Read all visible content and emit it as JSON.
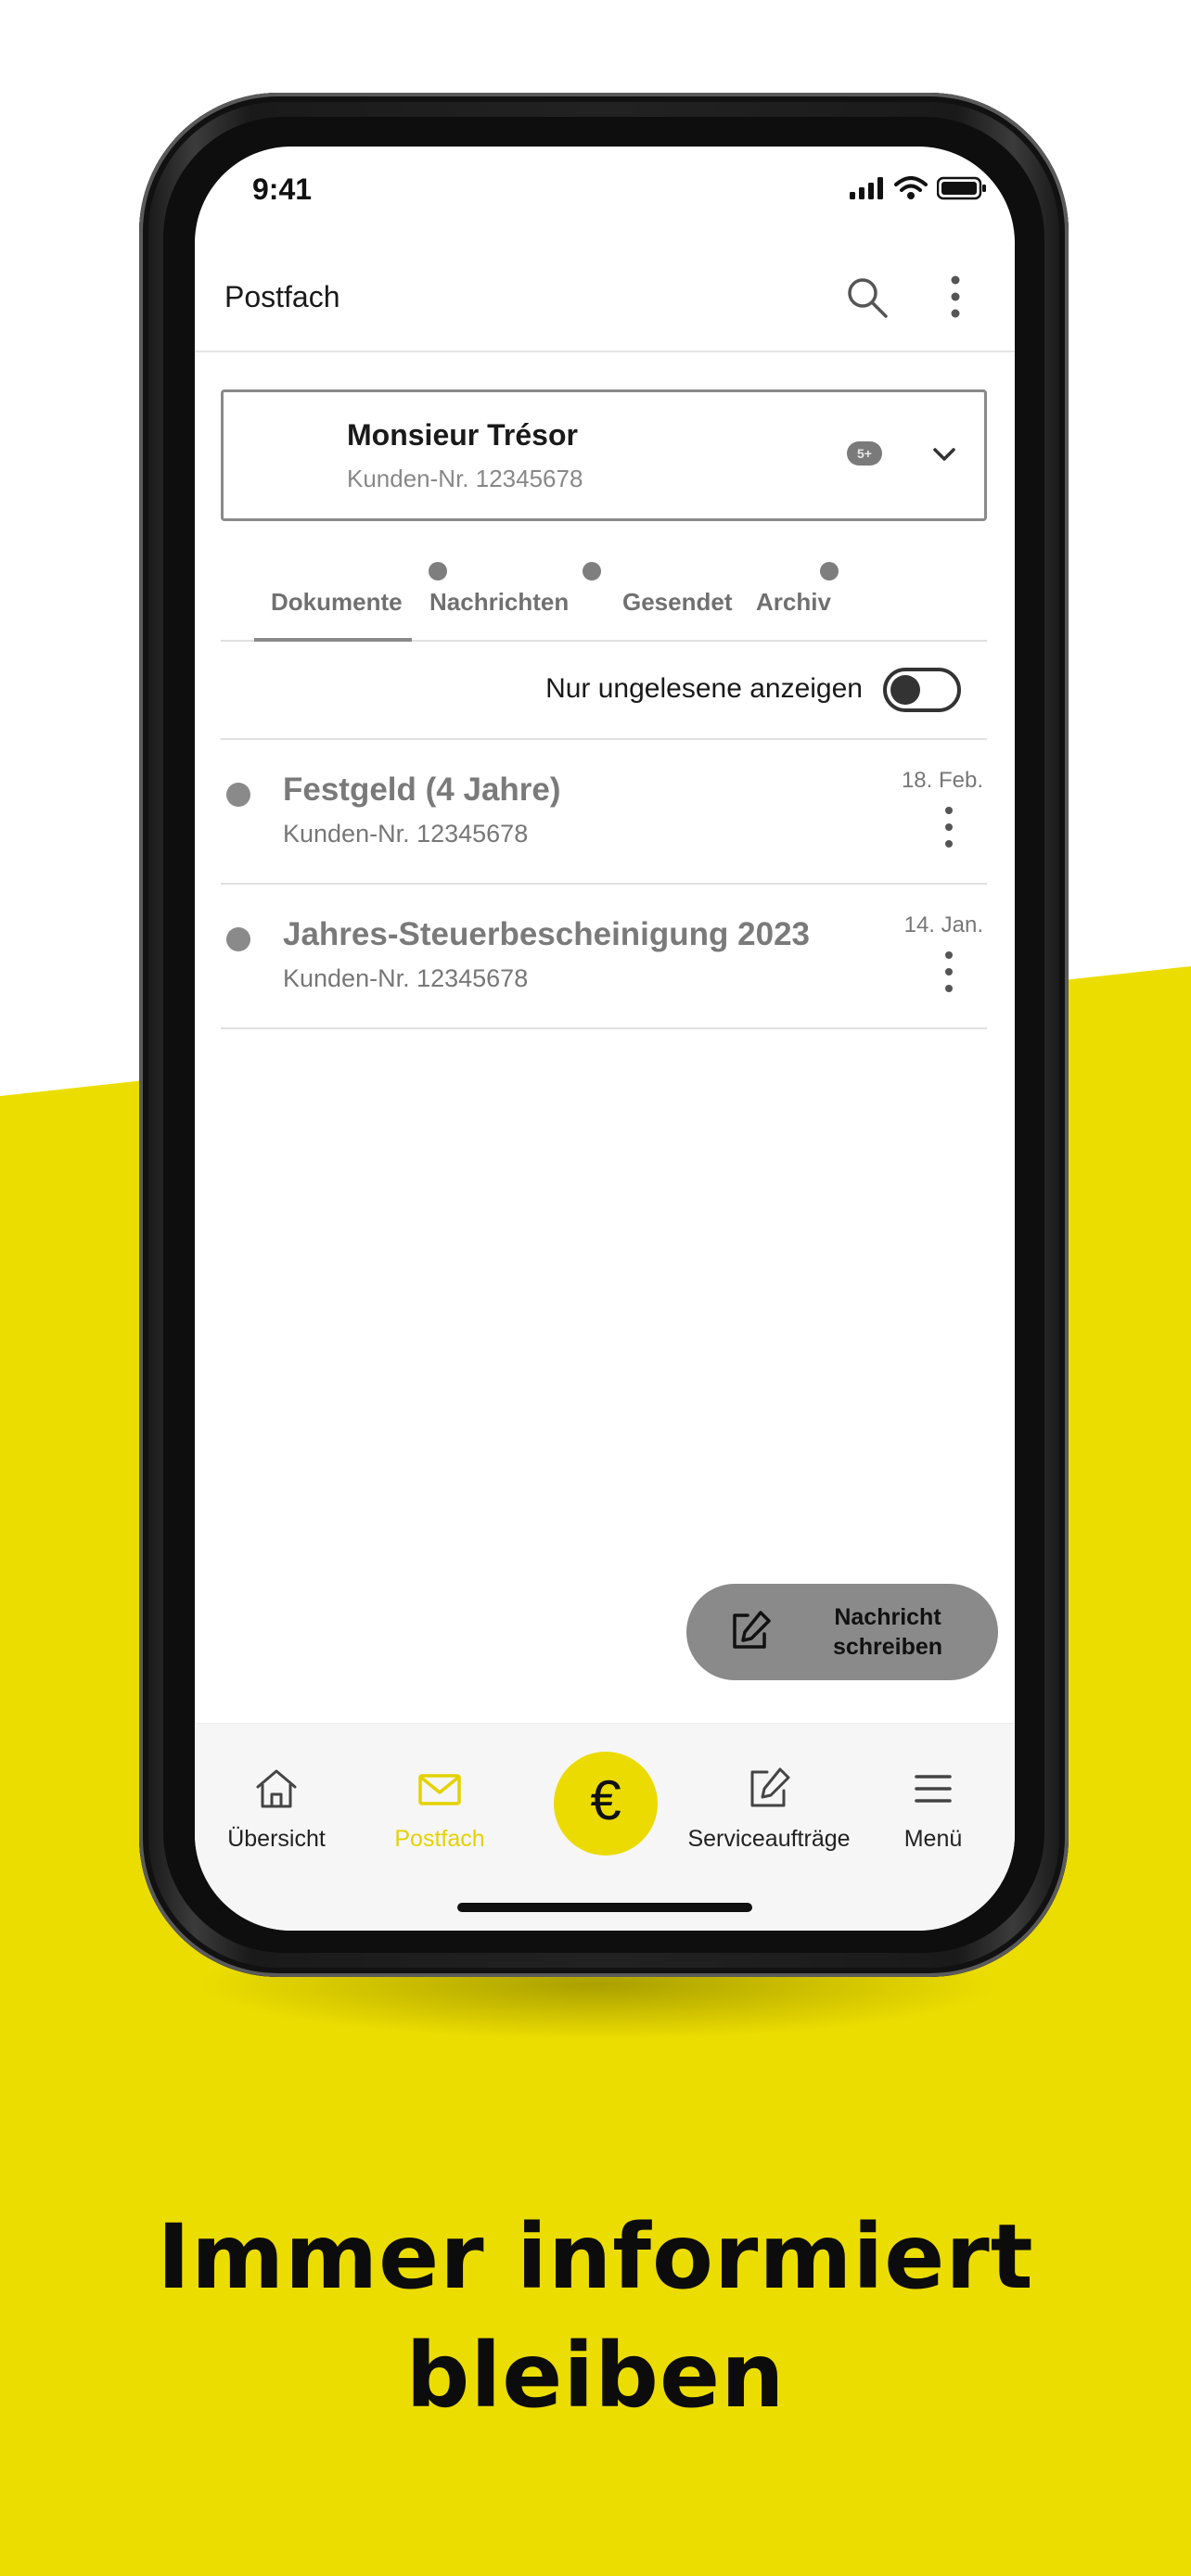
{
  "colors": {
    "brand_yellow": "#ecdd00",
    "active_nav": "#e4d200",
    "muted_gray": "#8a8a8a"
  },
  "status_bar": {
    "time": "9:41",
    "icons": [
      "cellular-signal-icon",
      "wifi-icon",
      "battery-icon"
    ]
  },
  "header": {
    "title": "Postfach",
    "icons": [
      "search-icon",
      "more-vertical-icon"
    ]
  },
  "account": {
    "name": "Monsieur Trésor",
    "customer_no": "Kunden-Nr. 12345678",
    "badge": "5+"
  },
  "tabs": [
    {
      "label": "Dokumente",
      "active": true,
      "has_dot": true
    },
    {
      "label": "Nachrichten",
      "active": false,
      "has_dot": true
    },
    {
      "label": "Gesendet",
      "active": false,
      "has_dot": false
    },
    {
      "label": "Archiv",
      "active": false,
      "has_dot": true
    }
  ],
  "filter": {
    "label": "Nur ungelesene anzeigen",
    "enabled": false
  },
  "documents": [
    {
      "title": "Festgeld (4 Jahre)",
      "subtitle": "Kunden-Nr. 12345678",
      "date": "18. Feb."
    },
    {
      "title": "Jahres-Steuerbescheinigung 2023",
      "subtitle": "Kunden-Nr. 12345678",
      "date": "14. Jan."
    }
  ],
  "compose": {
    "label": "Nachricht schreiben",
    "icon": "edit-icon"
  },
  "bottom_nav": [
    {
      "label": "Übersicht",
      "icon": "home-icon",
      "active": false
    },
    {
      "label": "Postfach",
      "icon": "mail-icon",
      "active": true
    },
    {
      "label": "",
      "icon": "euro-icon",
      "glyph": "€",
      "active": false
    },
    {
      "label": "Serviceaufträge",
      "icon": "edit-icon",
      "active": false
    },
    {
      "label": "Menü",
      "icon": "menu-icon",
      "active": false
    }
  ],
  "headline": {
    "line1": "Immer informiert",
    "line2": "bleiben"
  }
}
